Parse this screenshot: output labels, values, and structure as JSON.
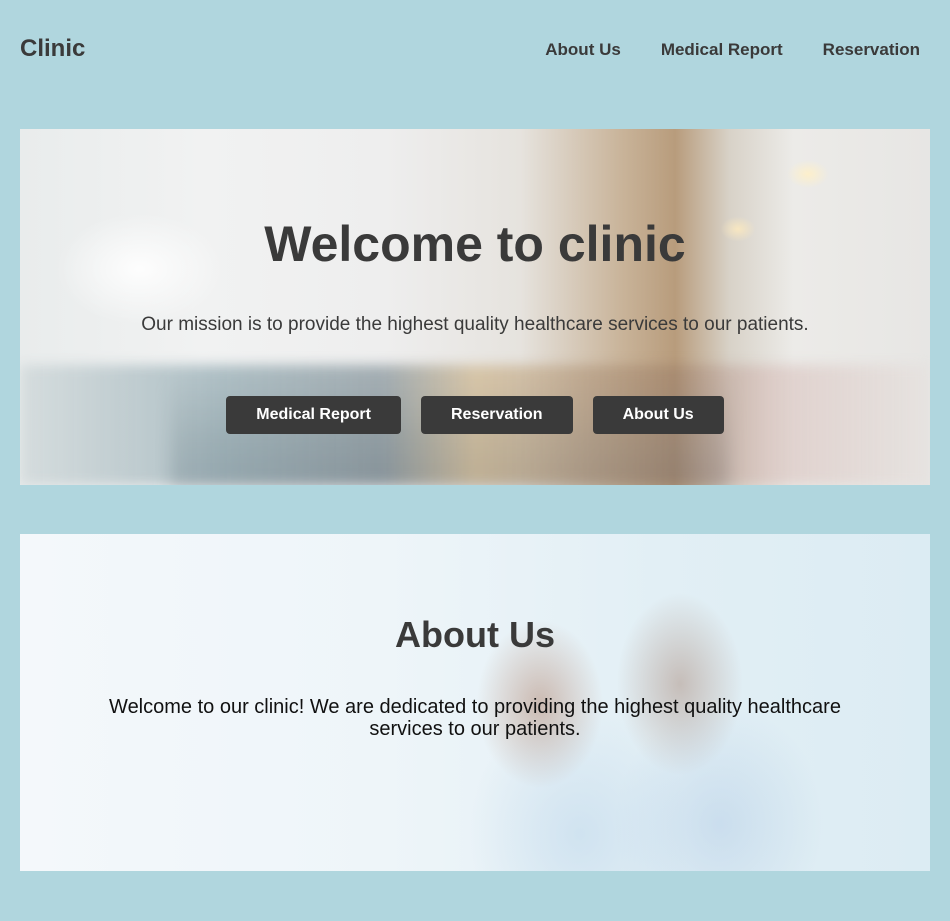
{
  "header": {
    "brand": "Clinic",
    "nav": [
      "About Us",
      "Medical Report",
      "Reservation"
    ]
  },
  "hero": {
    "title": "Welcome to clinic",
    "subtitle": "Our mission is to provide the highest quality healthcare services to our patients.",
    "buttons": [
      "Medical Report",
      "Reservation",
      "About Us"
    ]
  },
  "about": {
    "title": "About Us",
    "text": "Welcome to our clinic! We are dedicated to providing the highest quality healthcare services to our patients."
  },
  "colors": {
    "page_background": "#b0d6de",
    "text": "#3a3a3a",
    "button_background": "#3a3a3a",
    "button_text": "#ffffff"
  }
}
